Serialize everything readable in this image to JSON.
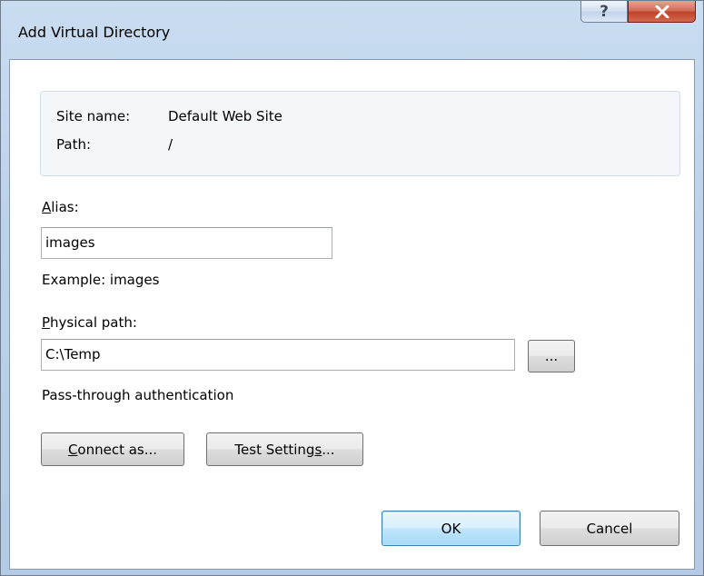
{
  "window": {
    "title": "Add Virtual Directory"
  },
  "titlebar": {
    "help_glyph": "?",
    "close_glyph": "x"
  },
  "info": {
    "site_name_label": "Site name:",
    "site_name_value": "Default Web Site",
    "path_label": "Path:",
    "path_value": "/"
  },
  "alias": {
    "label_mnemonic": "A",
    "label_rest": "lias:",
    "value": "images",
    "example": "Example: images"
  },
  "physical_path": {
    "label_mnemonic": "P",
    "label_rest": "hysical path:",
    "value": "C:\\Temp",
    "browse_label": "..."
  },
  "auth": {
    "label": "Pass-through authentication"
  },
  "buttons": {
    "connect_as_mnemonic": "C",
    "connect_as_rest": "onnect as...",
    "test_settings_pre": "Test Setting",
    "test_settings_mnemonic": "s",
    "test_settings_post": "...",
    "ok": "OK",
    "cancel": "Cancel"
  },
  "colors": {
    "frame": "#bcd2ea",
    "close_button": "#c0432b",
    "default_button_border": "#3c7fb1"
  }
}
